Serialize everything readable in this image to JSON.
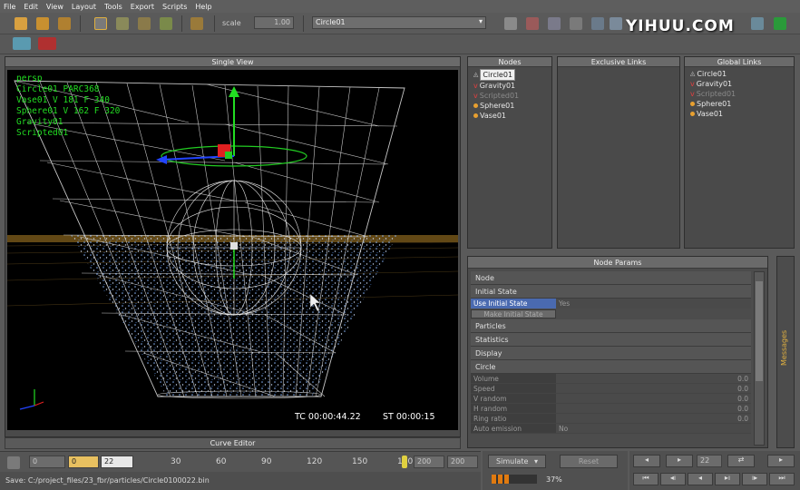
{
  "menu": [
    "File",
    "Edit",
    "View",
    "Layout",
    "Tools",
    "Export",
    "Scripts",
    "Help"
  ],
  "toolbar": {
    "scale_label": "scale",
    "scale_value": "1.00",
    "object_select": "Circle01"
  },
  "watermark": "YIHUU.COM",
  "single_view": {
    "title": "Single View",
    "hud": [
      "persp",
      "Circle01 PARC368",
      "Vase01 V 181 F 340",
      "Sphere01 V 162 F 320",
      "Gravity01",
      "Scripted01"
    ],
    "timecode": "TC 00:00:44.22",
    "sim_time": "ST 00:00:15"
  },
  "curve_editor_title": "Curve Editor",
  "nodes": {
    "title": "Nodes",
    "items": [
      {
        "icon": "circle-icon",
        "label": "Circle01",
        "color": "#ffffff",
        "selected": true
      },
      {
        "icon": "gravity-icon",
        "label": "Gravity01",
        "color": "#e8e8e8",
        "selected": false
      },
      {
        "icon": "script-icon",
        "label": "Scripted01",
        "color": "#8a8a8a",
        "selected": false
      },
      {
        "icon": "sphere-icon",
        "label": "Sphere01",
        "color": "#e8e8e8",
        "selected": false
      },
      {
        "icon": "vase-icon",
        "label": "Vase01",
        "color": "#e8e8e8",
        "selected": false
      }
    ]
  },
  "exclusive_links": {
    "title": "Exclusive Links"
  },
  "global_links": {
    "title": "Global Links",
    "items": [
      {
        "icon": "circle-icon",
        "label": "Circle01",
        "color": "#e8e8e8"
      },
      {
        "icon": "gravity-icon",
        "label": "Gravity01",
        "color": "#e8e8e8"
      },
      {
        "icon": "script-icon",
        "label": "Scripted01",
        "color": "#8a8a8a"
      },
      {
        "icon": "sphere-icon",
        "label": "Sphere01",
        "color": "#e8e8e8"
      },
      {
        "icon": "vase-icon",
        "label": "Vase01",
        "color": "#e8e8e8"
      }
    ]
  },
  "node_params": {
    "title": "Node Params",
    "sections": [
      "Node",
      "Initial State"
    ],
    "use_initial_state_label": "Use Initial State",
    "use_initial_state_value": "Yes",
    "make_initial_state": "Make Initial State",
    "sections2": [
      "Particles",
      "Statistics",
      "Display",
      "Circle"
    ],
    "rows": [
      {
        "k": "Volume",
        "v": "0.0"
      },
      {
        "k": "Speed",
        "v": "0.0"
      },
      {
        "k": "V random",
        "v": "0.0"
      },
      {
        "k": "H random",
        "v": "0.0"
      },
      {
        "k": "Ring ratio",
        "v": "0.0"
      }
    ],
    "last_row_label": "Auto emission",
    "last_row_value": "No"
  },
  "messages_label": "Messages",
  "timeline": {
    "start": "0",
    "current": "0",
    "frame": "22",
    "ticks": [
      "30",
      "60",
      "90",
      "120",
      "150",
      "180"
    ],
    "end1": "200",
    "end2": "200",
    "status": "Save: C:/project_files/23_fbr/particles/Circle0100022.bin"
  },
  "simulate": {
    "label": "Simulate",
    "reset": "Reset",
    "progress": "37%",
    "progress_value": 0.37
  },
  "transport": {
    "frame": "22"
  }
}
